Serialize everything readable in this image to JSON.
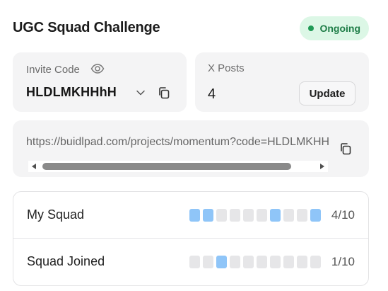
{
  "header": {
    "title": "UGC Squad Challenge",
    "status": "Ongoing"
  },
  "invite": {
    "label": "Invite Code",
    "code": "HLDLMKHHhH"
  },
  "posts": {
    "label": "X Posts",
    "count": "4",
    "update_label": "Update"
  },
  "link": {
    "url": "https://buidlpad.com/projects/momentum?code=HLDLMKHHhH"
  },
  "stats": [
    {
      "label": "My Squad",
      "count": "4/10",
      "slots": [
        true,
        true,
        false,
        false,
        false,
        false,
        true,
        false,
        false,
        true
      ]
    },
    {
      "label": "Squad Joined",
      "count": "1/10",
      "slots": [
        false,
        false,
        true,
        false,
        false,
        false,
        false,
        false,
        false,
        false
      ]
    }
  ],
  "colors": {
    "status_bg": "#dcf7e6",
    "status_text": "#1e7d47",
    "slot_filled": "#8fc5f8",
    "slot_empty": "#e6e6e8"
  },
  "icons": [
    "eye-icon",
    "chevron-down-icon",
    "copy-icon"
  ]
}
